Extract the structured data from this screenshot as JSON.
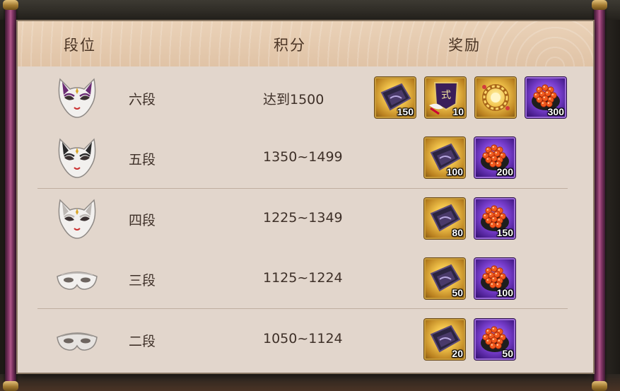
{
  "headers": {
    "rank": "段位",
    "score": "积分",
    "reward": "奖励"
  },
  "rows": [
    {
      "rank": "六段",
      "score": "达到1500",
      "mask": "fox-mask-purple-icon",
      "rewards": [
        {
          "icon": "purple-amulet-icon",
          "frame": "gold",
          "qty": "150"
        },
        {
          "icon": "banner-card-icon",
          "frame": "gold",
          "qty": "10"
        },
        {
          "icon": "golden-wreath-icon",
          "frame": "gold",
          "qty": ""
        },
        {
          "icon": "salmon-roe-sushi-icon",
          "frame": "purple",
          "qty": "300"
        }
      ]
    },
    {
      "rank": "五段",
      "score": "1350~1499",
      "mask": "fox-mask-black-icon",
      "rewards": [
        {
          "icon": "purple-amulet-icon",
          "frame": "gold",
          "qty": "100"
        },
        {
          "icon": "salmon-roe-sushi-icon",
          "frame": "purple",
          "qty": "200"
        }
      ]
    },
    {
      "rank": "四段",
      "score": "1225~1349",
      "mask": "fox-mask-white-icon",
      "rewards": [
        {
          "icon": "purple-amulet-icon",
          "frame": "gold",
          "qty": "80"
        },
        {
          "icon": "salmon-roe-sushi-icon",
          "frame": "purple",
          "qty": "150"
        }
      ]
    },
    {
      "rank": "三段",
      "score": "1125~1224",
      "mask": "half-mask-white-icon",
      "rewards": [
        {
          "icon": "purple-amulet-icon",
          "frame": "gold",
          "qty": "50"
        },
        {
          "icon": "salmon-roe-sushi-icon",
          "frame": "purple",
          "qty": "100"
        }
      ]
    },
    {
      "rank": "二段",
      "score": "1050~1124",
      "mask": "half-mask-grey-icon",
      "rewards": [
        {
          "icon": "purple-amulet-icon",
          "frame": "gold",
          "qty": "20"
        },
        {
          "icon": "salmon-roe-sushi-icon",
          "frame": "purple",
          "qty": "50"
        }
      ]
    }
  ],
  "colors": {
    "panel": "#e2d6cc",
    "header": "#e0c3a6",
    "text": "#3e3028",
    "gold_frame": "#c69a3a",
    "purple_frame": "#7a3fd0"
  }
}
